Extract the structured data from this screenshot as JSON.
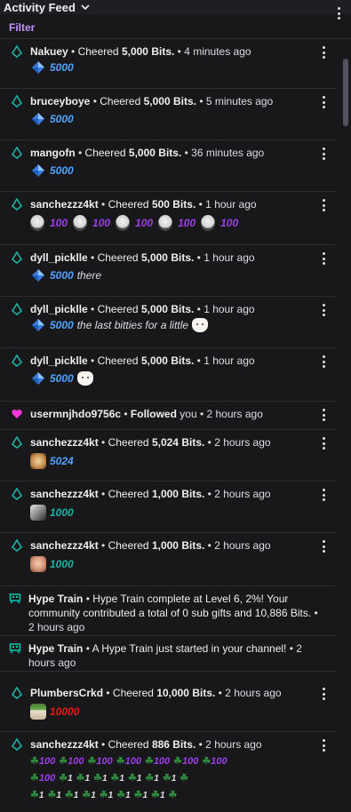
{
  "header": {
    "title": "Activity Feed"
  },
  "filter": {
    "label": "Filter"
  },
  "items": [
    {
      "user": "Nakuey",
      "sep": " • ",
      "action": "Cheered ",
      "bits": "5,000 Bits.",
      "time": " • 4 minutes ago",
      "amount": "5000"
    },
    {
      "user": "bruceyboye",
      "sep": " • ",
      "action": "Cheered ",
      "bits": "5,000 Bits.",
      "time": " • 5 minutes ago",
      "amount": "5000"
    },
    {
      "user": "mangofn",
      "sep": " • ",
      "action": "Cheered ",
      "bits": "5,000 Bits.",
      "time": " • 36 minutes ago",
      "amount": "5000"
    },
    {
      "user": "sanchezzz4kt",
      "sep": " • ",
      "action": "Cheered ",
      "bits": "500 Bits.",
      "time": " • 1 hour ago",
      "amount": "100"
    },
    {
      "user": "dyll_picklle",
      "sep": " • ",
      "action": "Cheered ",
      "bits": "5,000 Bits.",
      "time": " • 1 hour ago",
      "amount": "5000",
      "message": "there"
    },
    {
      "user": "dyll_picklle",
      "sep": " • ",
      "action": "Cheered ",
      "bits": "5,000 Bits.",
      "time": " • 1 hour ago",
      "amount": "5000",
      "message": "the last bitties for a little"
    },
    {
      "user": "dyll_picklle",
      "sep": " • ",
      "action": "Cheered ",
      "bits": "5,000 Bits.",
      "time": " • 1 hour ago",
      "amount": "5000"
    },
    {
      "user": "usermnjhdo9756c",
      "sep": " • ",
      "action": "Followed ",
      "target": "you",
      "time": " • 2 hours ago"
    },
    {
      "user": "sanchezzz4kt",
      "sep": " • ",
      "action": "Cheered ",
      "bits": "5,024 Bits.",
      "time": " • 2 hours ago",
      "amount": "5024"
    },
    {
      "user": "sanchezzz4kt",
      "sep": " • ",
      "action": "Cheered ",
      "bits": "1,000 Bits.",
      "time": " • 2 hours ago",
      "amount": "1000"
    },
    {
      "user": "sanchezzz4kt",
      "sep": " • ",
      "action": "Cheered ",
      "bits": "1,000 Bits.",
      "time": " • 2 hours ago",
      "amount": "1000"
    },
    {
      "user": "Hype Train",
      "sep": " • ",
      "text": "Hype Train complete at Level 6, 2%! Your community contributed a total of 0 sub gifts and 10,886 Bits.",
      "time": " • 2 hours ago"
    },
    {
      "user": "Hype Train",
      "sep": " • ",
      "text": "A Hype Train just started in your channel!",
      "time": " • 2 hours ago"
    },
    {
      "user": "PlumbersCrkd",
      "sep": " • ",
      "action": "Cheered ",
      "bits": "10,000 Bits.",
      "time": " • 2 hours ago",
      "amount": "10000"
    },
    {
      "user": "sanchezzz4kt",
      "sep": " • ",
      "action": "Cheered ",
      "bits": "886 Bits.",
      "time": " • 2 hours ago",
      "amount_100": "100",
      "amount_1": "1"
    }
  ],
  "colors": {
    "bits_blue": "#4fa3ff",
    "bits_purple": "#9c3ee8",
    "bits_teal": "#1db2a5",
    "bits_red": "#e91916",
    "follow_pink": "#ff38db",
    "hype_teal": "#00c8af"
  }
}
